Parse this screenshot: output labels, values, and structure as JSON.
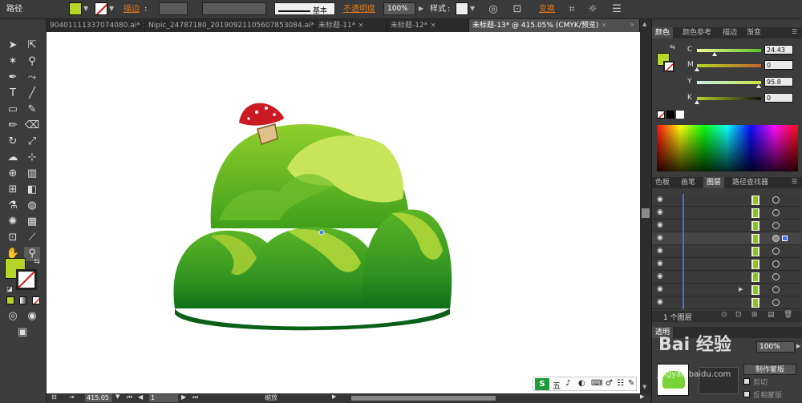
{
  "control_bar": {
    "object_type": "路径",
    "stroke_label": "描边",
    "stroke_profile": "基本",
    "opacity_label": "不透明度",
    "opacity_value": "100%",
    "style_label": "样式",
    "transform_label": "变换",
    "fill_color": "#b5d629"
  },
  "tabs": [
    {
      "label": "90401111337074080.ai*",
      "close": "×"
    },
    {
      "label": "Nipic_24787180_20190921105607853084.ai*",
      "close": "×"
    },
    {
      "label": "未标题-11*",
      "close": "×"
    },
    {
      "label": "未标题-12*",
      "close": "×"
    },
    {
      "label": "未标题-13* @ 415.05% (CMYK/预览)",
      "close": "×"
    }
  ],
  "color_panel": {
    "tabs": [
      "颜色",
      "颜色参考",
      "描边",
      "渐变"
    ],
    "channels": [
      {
        "name": "C",
        "value": "24.43",
        "level": 0.24
      },
      {
        "name": "M",
        "value": "0",
        "level": 0.0
      },
      {
        "name": "Y",
        "value": "95.8",
        "level": 0.96
      },
      {
        "name": "K",
        "value": "0",
        "level": 0.0
      }
    ],
    "current_fill": "#b5d629"
  },
  "layers_panel": {
    "tabs": [
      "色板",
      "画笔",
      "图层",
      "路径查找器"
    ],
    "footer_label": "1 个图层"
  },
  "lower_panel": {
    "tab_label": "透明",
    "opacity_value": "100%",
    "make_mask_button": "制作蒙版",
    "clip_option": "剪切",
    "invert_mask_option": "反相蒙版"
  },
  "status_bar": {
    "zoom": "415.05",
    "artboard": "1",
    "tool_label": "缩放"
  },
  "ime_bar": {
    "mode": "五"
  },
  "watermark": {
    "text": "Bai 经验",
    "url": "jingyan.baidu.com"
  }
}
